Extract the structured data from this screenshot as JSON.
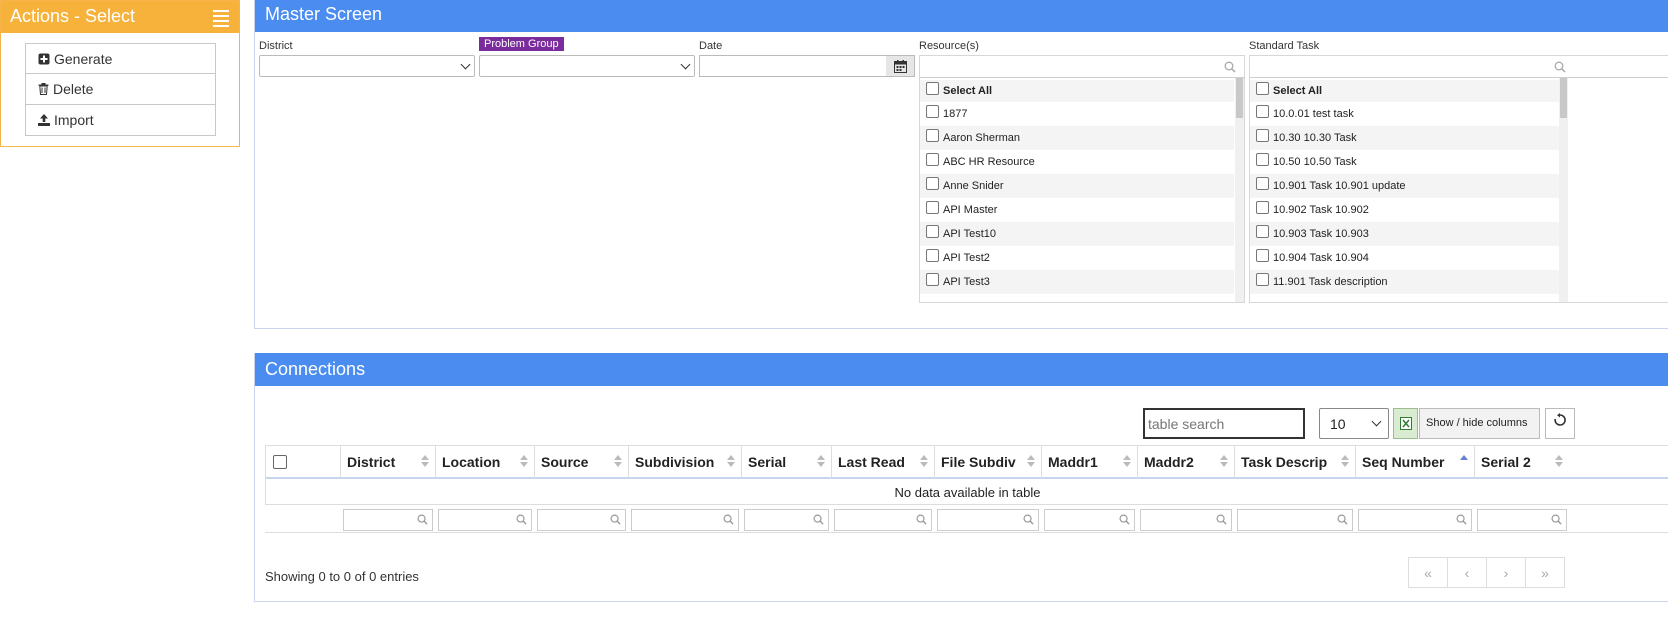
{
  "actions": {
    "title": "Actions - Select",
    "items": [
      {
        "label": "Generate",
        "icon": "plus-square-icon"
      },
      {
        "label": "Delete",
        "icon": "trash-icon"
      },
      {
        "label": "Import",
        "icon": "upload-icon"
      }
    ]
  },
  "master": {
    "title": "Master Screen",
    "district_label": "District",
    "problem_group_label": "Problem Group",
    "date_label": "Date",
    "resources_label": "Resource(s)",
    "standard_task_label": "Standard Task",
    "resources": {
      "select_all": "Select All",
      "items": [
        "1877",
        "Aaron Sherman",
        "ABC HR Resource",
        "Anne Snider",
        "API Master",
        "API Test10",
        "API Test2",
        "API Test3"
      ]
    },
    "standard_task": {
      "select_all": "Select All",
      "items": [
        "10.0.01 test task",
        "10.30 10.30 Task",
        "10.50 10.50 Task",
        "10.901 Task 10.901 update",
        "10.902 Task 10.902",
        "10.903 Task 10.903",
        "10.904 Task 10.904",
        "11.901 Task description"
      ]
    }
  },
  "connections": {
    "title": "Connections",
    "search_placeholder": "table search",
    "page_size": "10",
    "show_hide_label": "Show / hide columns",
    "columns": [
      "District",
      "Location",
      "Source",
      "Subdivision",
      "Serial",
      "Last Read",
      "File Subdiv",
      "Maddr1",
      "Maddr2",
      "Task Descrip",
      "Seq Number",
      "Serial 2"
    ],
    "sorted_column": "Seq Number",
    "empty_message": "No data available in table",
    "info": "Showing 0 to 0 of 0 entries",
    "pager": [
      "«",
      "‹",
      "›",
      "»"
    ]
  },
  "colors": {
    "actions_header": "#f7b23b",
    "section_header": "#4a8cf0",
    "problem_group_badge": "#7a2b9c"
  }
}
